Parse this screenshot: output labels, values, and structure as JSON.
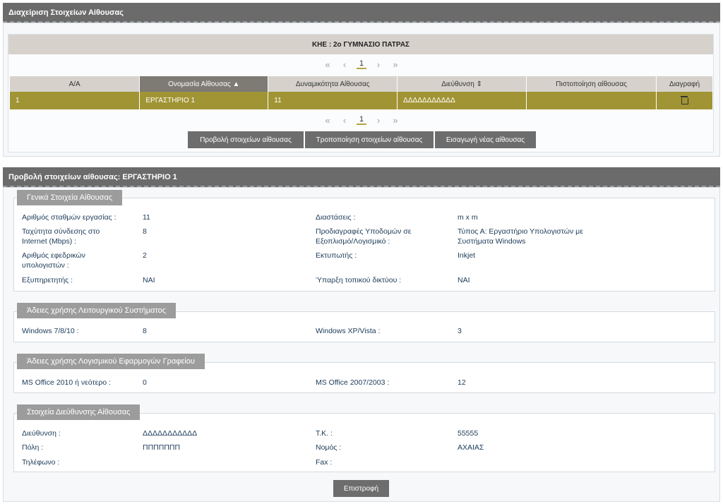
{
  "panel1": {
    "title": "Διαχείριση Στοιχείων Αίθουσας",
    "caption": "ΚΗΕ : 2ο ΓΥΜΝΑΣΙΟ ΠΑΤΡΑΣ",
    "pager": {
      "first": "«",
      "prev": "‹",
      "page": "1",
      "next": "›",
      "last": "»"
    },
    "columns": [
      "Α/Α",
      "Ονομασία Αίθουσας",
      "Δυναμικότητα Αίθουσας",
      "Διεύθυνση",
      "Πιστοποίηση αίθουσας",
      "Διαγραφή"
    ],
    "rows": [
      {
        "aa": "1",
        "name": "ΕΡΓΑΣΤΗΡΙΟ 1",
        "capacity": "11",
        "address": "ΔΔΔΔΔΔΔΔΔΔΔ",
        "cert": ""
      }
    ],
    "buttons": {
      "view": "Προβολή στοιχείων αίθουσας",
      "edit": "Τροποποίηση στοιχείων αίθουσας",
      "add": "Εισαγωγή νέας αίθουσας"
    }
  },
  "panel2": {
    "title": "Προβολή στοιχείων αίθουσας: ΕΡΓΑΣΤΗΡΙΟ 1",
    "general": {
      "legend": "Γενικά Στοιχεία Αίθουσας",
      "workstations_label": "Αριθμός σταθμών εργασίας :",
      "workstations_value": "11",
      "dimensions_label": "Διαστάσεις :",
      "dimensions_value": "m x m",
      "speed_label": "Ταχύτητα σύνδεσης στο Internet (Mbps) :",
      "speed_value": "8",
      "specs_label": "Προδιαγραφές Υποδομών σε Εξοπλισμό/Λογισμικό :",
      "specs_value": "Τύπος Α: Εργαστήριο Υπολογιστών με Συστήματα Windows",
      "spare_label": "Αριθμός εφεδρικών υπολογιστών :",
      "spare_value": "2",
      "printer_label": "Εκτυπωτής :",
      "printer_value": "Inkjet",
      "server_label": "Εξυπηρετητής :",
      "server_value": "ΝΑΙ",
      "lan_label": "Ύπαρξη τοπικού δικτύου :",
      "lan_value": "ΝΑΙ"
    },
    "os": {
      "legend": "Άδειες χρήσης Λειτουργικού Συστήματος",
      "win7_label": "Windows 7/8/10 :",
      "win7_value": "8",
      "winxp_label": "Windows XP/Vista :",
      "winxp_value": "3"
    },
    "office": {
      "legend": "Άδειες χρήσης Λογισμικού Εφαρμογών Γραφείου",
      "new_label": "MS Office 2010 ή νεότερο :",
      "new_value": "0",
      "old_label": "MS Office 2007/2003 :",
      "old_value": "12"
    },
    "address": {
      "legend": "Στοιχεία Διεύθυνσης Αίθουσας",
      "addr_label": "Διεύθυνση :",
      "addr_value": "ΔΔΔΔΔΔΔΔΔΔΔ",
      "tk_label": "Τ.Κ. :",
      "tk_value": "55555",
      "city_label": "Πόλη :",
      "city_value": "ΠΠΠΠΠΠΠ",
      "prefecture_label": "Νομός :",
      "prefecture_value": "ΑΧΑΙΑΣ",
      "phone_label": "Τηλέφωνο :",
      "phone_value": "",
      "fax_label": "Fax :",
      "fax_value": ""
    },
    "back_button": "Επιστροφή"
  },
  "colors": {
    "header": "#6b6b6b",
    "selected_row": "#a19434",
    "button": "#6d6d6d",
    "legend": "#9c9c9c"
  }
}
